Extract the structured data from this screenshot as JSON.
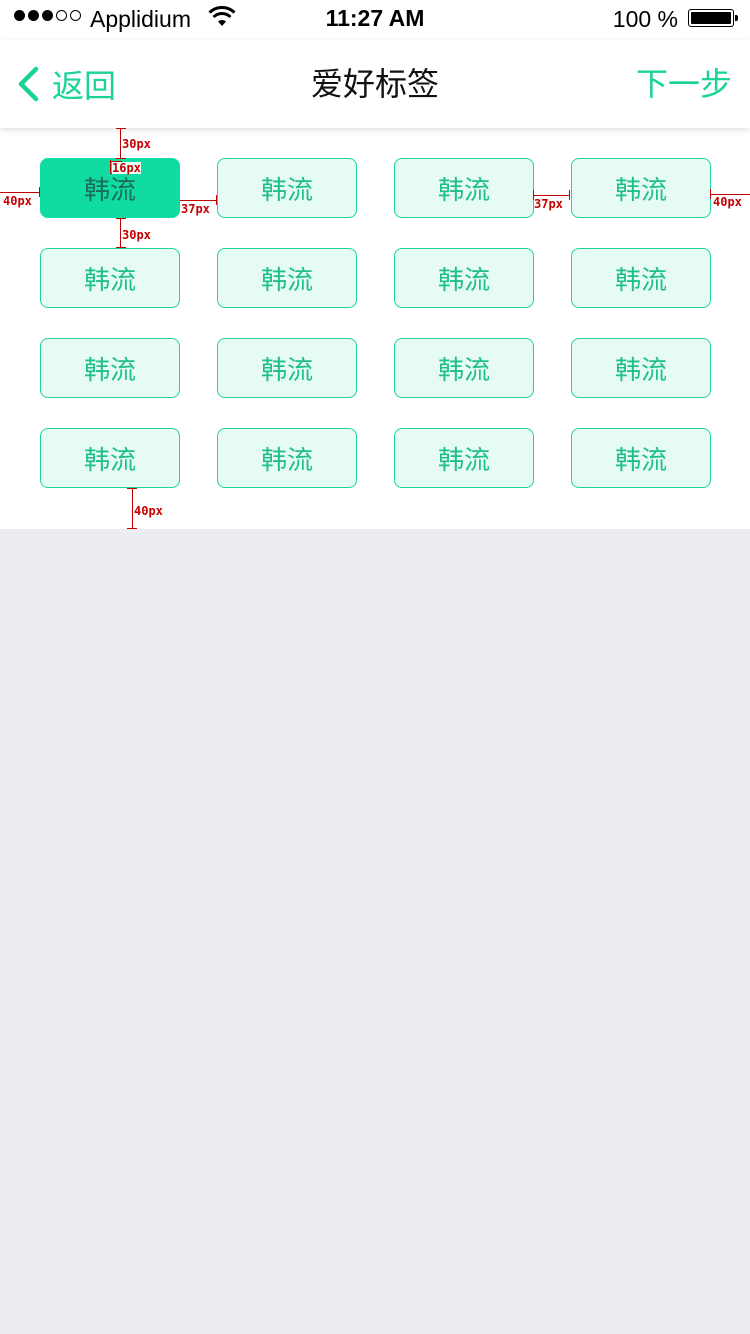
{
  "status_bar": {
    "carrier": "Applidium",
    "time": "11:27 AM",
    "battery": "100 %"
  },
  "nav": {
    "back_label": "返回",
    "title": "爱好标签",
    "next_label": "下一步"
  },
  "tags": [
    {
      "label": "韩流",
      "selected": true
    },
    {
      "label": "韩流",
      "selected": false
    },
    {
      "label": "韩流",
      "selected": false
    },
    {
      "label": "韩流",
      "selected": false
    },
    {
      "label": "韩流",
      "selected": false
    },
    {
      "label": "韩流",
      "selected": false
    },
    {
      "label": "韩流",
      "selected": false
    },
    {
      "label": "韩流",
      "selected": false
    },
    {
      "label": "韩流",
      "selected": false
    },
    {
      "label": "韩流",
      "selected": false
    },
    {
      "label": "韩流",
      "selected": false
    },
    {
      "label": "韩流",
      "selected": false
    },
    {
      "label": "韩流",
      "selected": false
    },
    {
      "label": "韩流",
      "selected": false
    },
    {
      "label": "韩流",
      "selected": false
    },
    {
      "label": "韩流",
      "selected": false
    }
  ],
  "annotations": {
    "top_gap": "30px",
    "font_size": "16px",
    "row_gap": "30px",
    "left_margin": "40px",
    "col_gap_a": "37px",
    "col_gap_b": "37px",
    "right_margin": "40px",
    "bottom_gap": "40px"
  },
  "colors": {
    "accent": "#19d399",
    "tag_border": "#22d3a0",
    "tag_bg": "#e6fbf4",
    "tag_selected_bg": "#10dba0",
    "page_bg": "#ebedf0",
    "annotation": "#c40000"
  }
}
